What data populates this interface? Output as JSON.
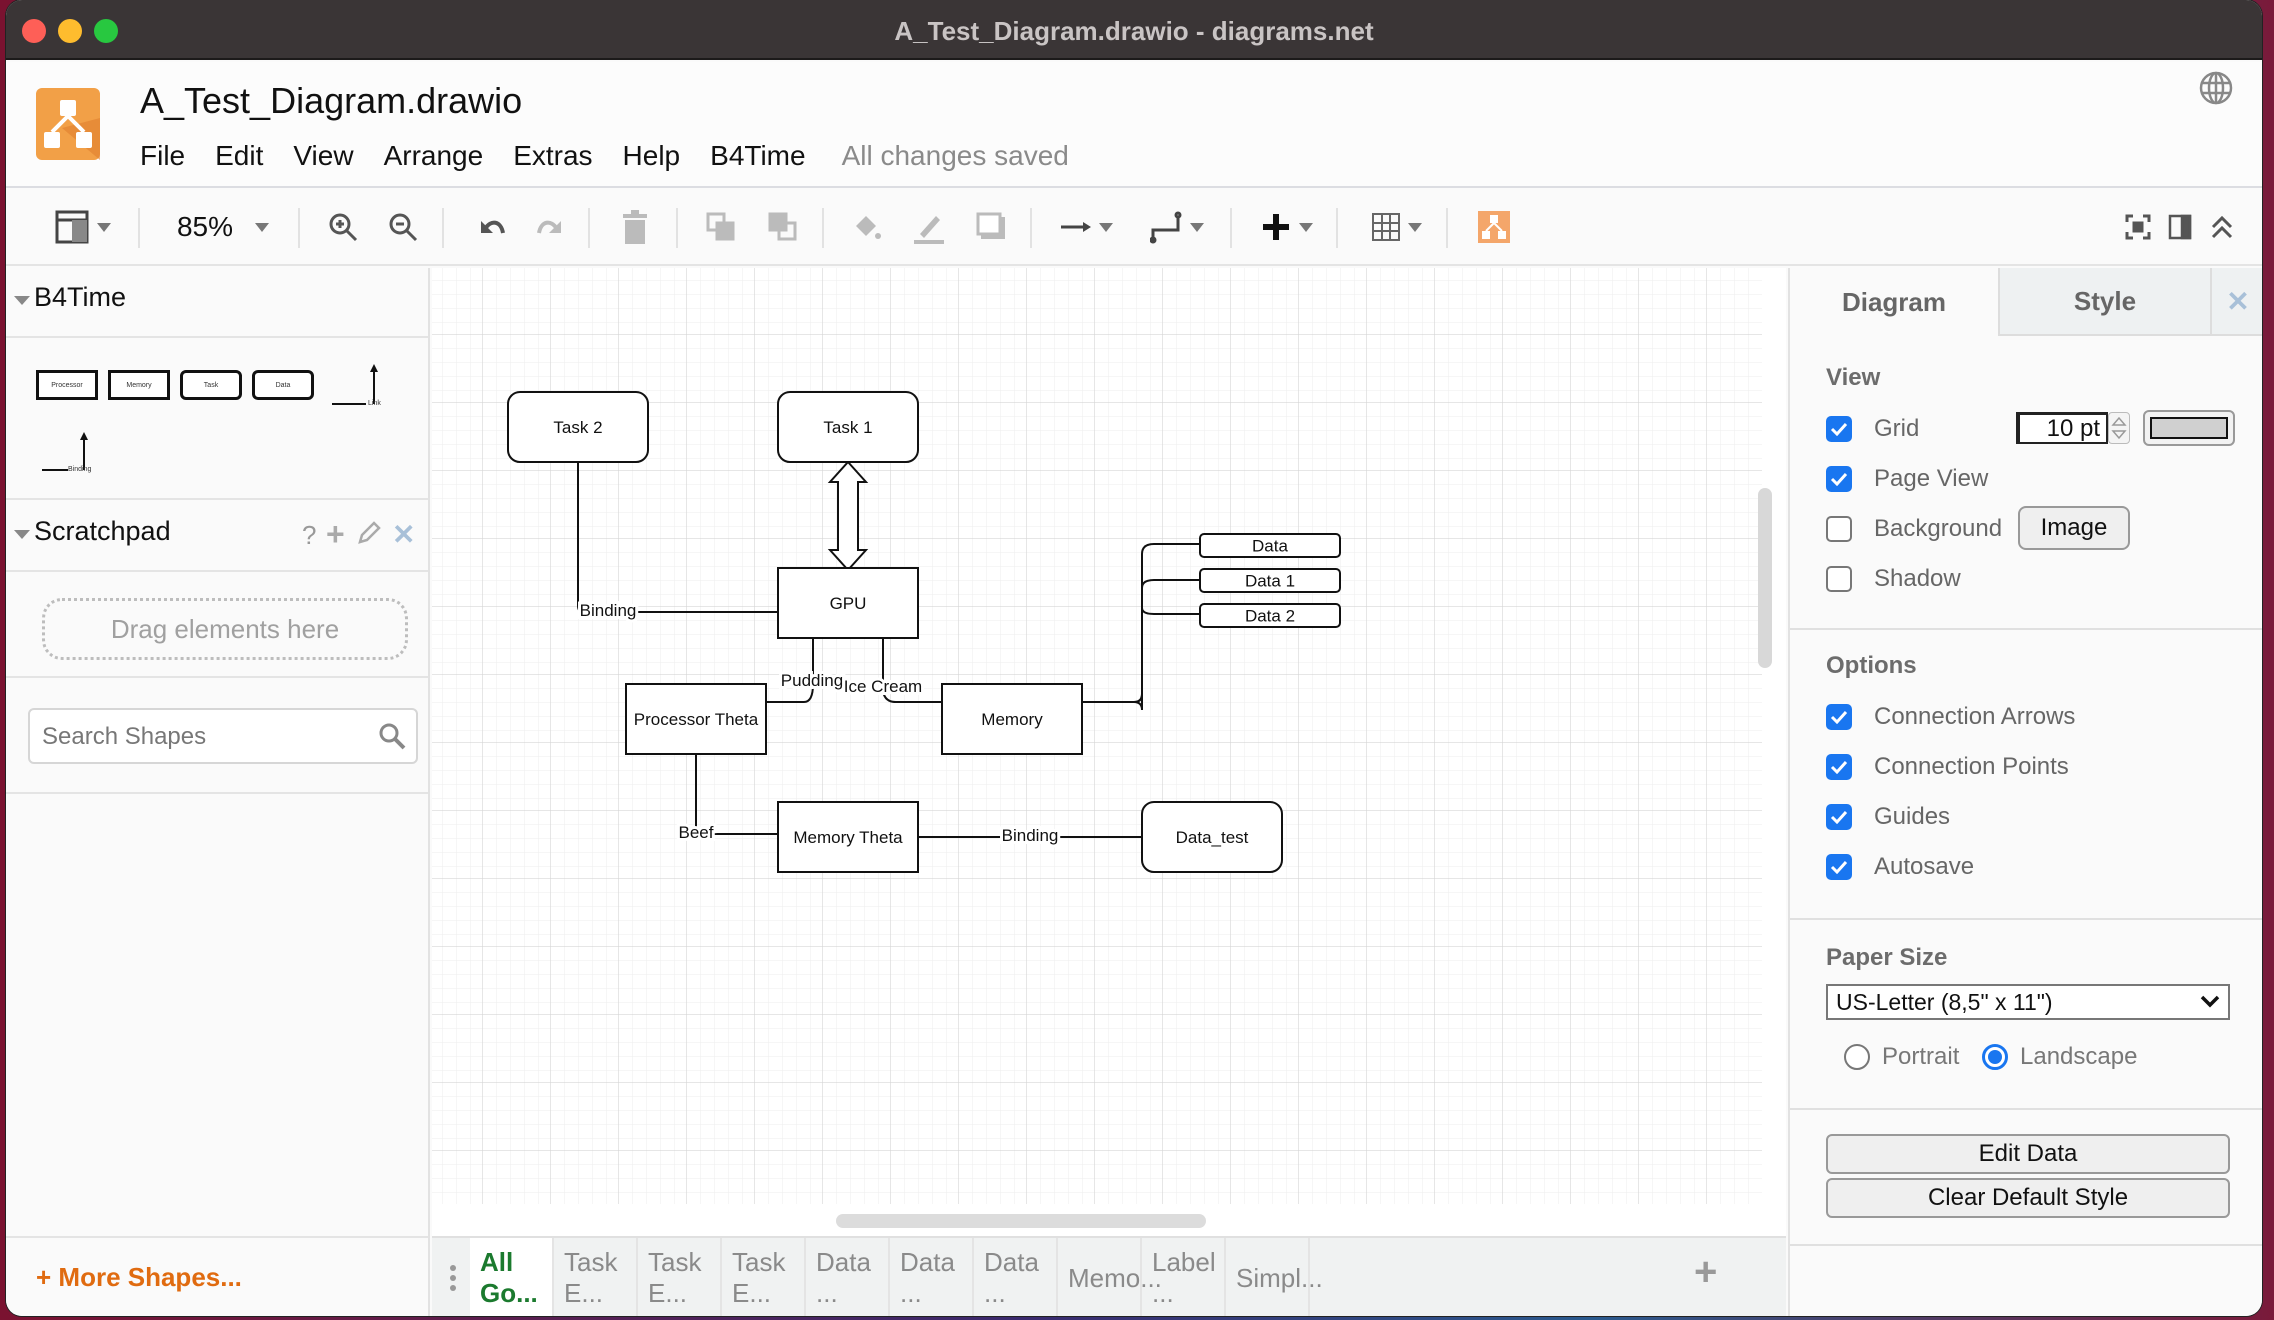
{
  "window": {
    "title": "A_Test_Diagram.drawio - diagrams.net"
  },
  "header": {
    "doc_title": "A_Test_Diagram.drawio",
    "menu": [
      "File",
      "Edit",
      "View",
      "Arrange",
      "Extras",
      "Help",
      "B4Time"
    ],
    "save_status": "All changes saved",
    "language_icon": "globe-icon"
  },
  "toolbar": {
    "zoom": "85%",
    "icons": [
      "format-panel-icon",
      "zoom-in-icon",
      "zoom-out-icon",
      "undo-icon",
      "redo-icon",
      "delete-icon",
      "to-front-icon",
      "to-back-icon",
      "fill-color-icon",
      "line-color-icon",
      "shadow-icon",
      "connection-icon",
      "waypoints-icon",
      "insert-icon",
      "table-icon",
      "drawio-logo-icon",
      "fullscreen-icon",
      "toggle-panel-icon",
      "collapse-icon"
    ]
  },
  "sidebar": {
    "library_title": "B4Time",
    "library_shapes": [
      {
        "label": "Processor",
        "kind": "rect"
      },
      {
        "label": "Memory",
        "kind": "rect"
      },
      {
        "label": "Task",
        "kind": "rounded"
      },
      {
        "label": "Data",
        "kind": "rounded"
      },
      {
        "label": "Link",
        "kind": "edge"
      },
      {
        "label": "Binding",
        "kind": "edge"
      }
    ],
    "scratchpad_title": "Scratchpad",
    "scratchpad_drop": "Drag elements here",
    "scratchpad_icons": [
      "help-icon",
      "add-icon",
      "edit-icon",
      "close-icon"
    ],
    "search_placeholder": "Search Shapes",
    "more_shapes": "+ More Shapes..."
  },
  "diagram": {
    "nodes": [
      {
        "id": "task2",
        "label": "Task 2",
        "shape": "rounded"
      },
      {
        "id": "task1",
        "label": "Task 1",
        "shape": "rounded"
      },
      {
        "id": "gpu",
        "label": "GPU",
        "shape": "rect"
      },
      {
        "id": "proc",
        "label": "Processor Theta",
        "shape": "rect"
      },
      {
        "id": "mem",
        "label": "Memory",
        "shape": "rect"
      },
      {
        "id": "data",
        "label": "Data",
        "shape": "rounded"
      },
      {
        "id": "data1",
        "label": "Data 1",
        "shape": "rounded"
      },
      {
        "id": "data2",
        "label": "Data 2",
        "shape": "rounded"
      },
      {
        "id": "memtheta",
        "label": "Memory Theta",
        "shape": "rect"
      },
      {
        "id": "datatest",
        "label": "Data_test",
        "shape": "rounded"
      }
    ],
    "edges": [
      {
        "from": "task2",
        "to": "gpu",
        "label": "Binding"
      },
      {
        "from": "task1",
        "to": "gpu",
        "label": "",
        "style": "double-arrow"
      },
      {
        "from": "gpu",
        "to": "proc",
        "label": "Pudding"
      },
      {
        "from": "gpu",
        "to": "mem",
        "label": "Ice Cream"
      },
      {
        "from": "mem",
        "to": "data",
        "label": ""
      },
      {
        "from": "mem",
        "to": "data1",
        "label": ""
      },
      {
        "from": "mem",
        "to": "data2",
        "label": ""
      },
      {
        "from": "proc",
        "to": "memtheta",
        "label": "Beef"
      },
      {
        "from": "memtheta",
        "to": "datatest",
        "label": "Binding"
      }
    ]
  },
  "format_panel": {
    "tabs": [
      "Diagram",
      "Style"
    ],
    "active_tab": "Diagram",
    "view_title": "View",
    "view_options": [
      {
        "label": "Grid",
        "checked": true
      },
      {
        "label": "Page View",
        "checked": true
      },
      {
        "label": "Background",
        "checked": false
      },
      {
        "label": "Shadow",
        "checked": false
      }
    ],
    "grid_size": "10 pt",
    "grid_color": "#d0d0d0",
    "background_image_button": "Image",
    "options_title": "Options",
    "options": [
      {
        "label": "Connection Arrows",
        "checked": true
      },
      {
        "label": "Connection Points",
        "checked": true
      },
      {
        "label": "Guides",
        "checked": true
      },
      {
        "label": "Autosave",
        "checked": true
      }
    ],
    "paper_size_title": "Paper Size",
    "paper_size": "US-Letter (8,5\" x 11\")",
    "orientation": [
      {
        "label": "Portrait",
        "selected": false
      },
      {
        "label": "Landscape",
        "selected": true
      }
    ],
    "edit_data_button": "Edit Data",
    "clear_style_button": "Clear Default Style"
  },
  "page_tabs": {
    "tabs": [
      "All Go...",
      "Task E...",
      "Task E...",
      "Task E...",
      "Data ...",
      "Data ...",
      "Data ...",
      "Memo...",
      "Label ...",
      "Simpl..."
    ],
    "active_index": 0
  },
  "colors": {
    "accent_blue": "#1976f0",
    "brand_orange": "#f08705",
    "active_tab_green": "#1b7a2e",
    "more_shapes_orange": "#e06b10"
  }
}
